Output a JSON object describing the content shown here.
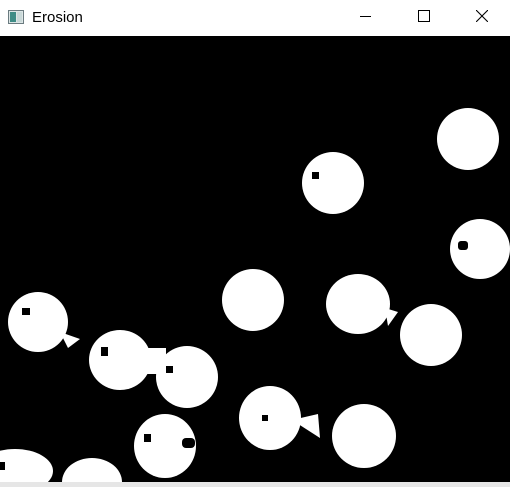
{
  "window": {
    "title": "Erosion",
    "app_icon": "image-window-icon",
    "controls": [
      "minimize-icon",
      "maximize-icon",
      "close-icon"
    ]
  },
  "image": {
    "description_type": "binary-eroded-image",
    "foreground_color": "#ffffff",
    "background_color": "#000000"
  }
}
